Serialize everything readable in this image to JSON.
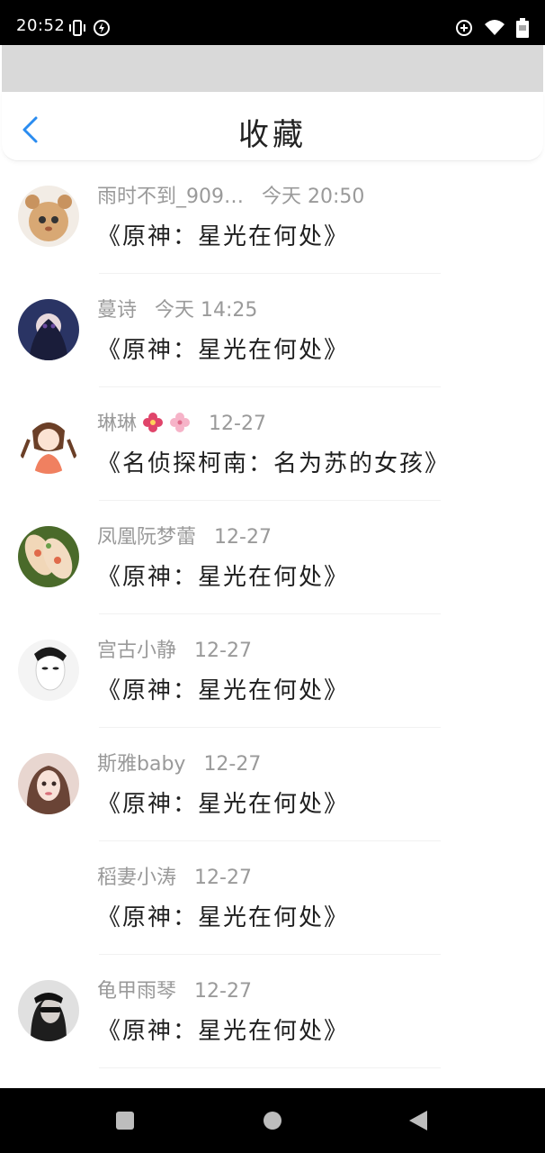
{
  "status_bar": {
    "time": "20:52",
    "icons": [
      "vibrate-icon",
      "charging-bolt-icon",
      "data-saver-icon",
      "wifi-icon",
      "battery-icon"
    ]
  },
  "header": {
    "title": "收藏",
    "back_icon": "chevron-left-icon",
    "accent_color": "#2a8cf0"
  },
  "favorites": [
    {
      "user": "雨时不到_909…",
      "time": "今天 20:50",
      "content": "《原神：星光在何处》"
    },
    {
      "user": "蔓诗",
      "time": "今天 14:25",
      "content": "《原神：星光在何处》"
    },
    {
      "user": "琳琳",
      "time": "12-27",
      "content": "《名侦探柯南：名为苏的女孩》"
    },
    {
      "user": "凤凰阮梦蕾",
      "time": "12-27",
      "content": "《原神：星光在何处》"
    },
    {
      "user": "宫古小静",
      "time": "12-27",
      "content": "《原神：星光在何处》"
    },
    {
      "user": "斯雅baby",
      "time": "12-27",
      "content": "《原神：星光在何处》"
    },
    {
      "user": "稻妻小涛",
      "time": "12-27",
      "content": "《原神：星光在何处》"
    },
    {
      "user": "龟甲雨琴",
      "time": "12-27",
      "content": "《原神：星光在何处》"
    }
  ],
  "system_nav": {
    "icons": [
      "recents-square-icon",
      "home-circle-icon",
      "back-triangle-icon"
    ]
  }
}
